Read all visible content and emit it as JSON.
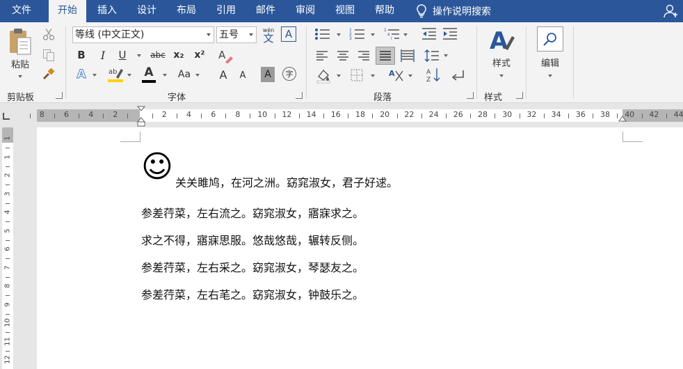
{
  "tabs": {
    "file": "文件",
    "home": "开始",
    "insert": "插入",
    "design": "设计",
    "layout": "布局",
    "references": "引用",
    "mailings": "邮件",
    "review": "审阅",
    "view": "视图",
    "help": "帮助"
  },
  "tell_me": "操作说明搜索",
  "clipboard": {
    "paste": "粘贴",
    "label": "剪贴板"
  },
  "font": {
    "name": "等线 (中文正文)",
    "size": "五号",
    "phonetic": "wén",
    "phonetic_char": "文",
    "border_char": "A",
    "bold": "B",
    "italic": "I",
    "underline": "U",
    "strike": "abc",
    "sub": "x₂",
    "sup": "x²",
    "text_effects": "A",
    "font_color": "A",
    "case": "Aa",
    "grow": "A",
    "shrink": "A",
    "shading": "A",
    "enclose": "字",
    "label": "字体",
    "highlight_color": "#ffd200",
    "font_color_bar": "#000000"
  },
  "paragraph": {
    "label": "段落"
  },
  "styles": {
    "button": "样式",
    "label": "样式"
  },
  "editing": {
    "button": "编辑"
  },
  "ruler": {
    "h": [
      "8",
      "6",
      "4",
      "2",
      "",
      "2",
      "4",
      "6",
      "8",
      "10",
      "12",
      "14",
      "16",
      "18",
      "20",
      "22",
      "24",
      "26",
      "28",
      "30",
      "32",
      "34",
      "36",
      "38",
      "40",
      "42",
      "44"
    ],
    "v": [
      "1",
      "1",
      "2",
      "3",
      "4",
      "5",
      "6",
      "7",
      "8",
      "9",
      "10",
      "11",
      "12"
    ]
  },
  "document": {
    "emoji": "☺",
    "lines": [
      "关关雎鸠，在河之洲。窈窕淑女，君子好逑。",
      "参差荇菜，左右流之。窈窕淑女，寤寐求之。",
      "求之不得，寤寐思服。悠哉悠哉，辗转反侧。",
      "参差荇菜，左右采之。窈窕淑女，琴瑟友之。",
      "参差荇菜，左右芼之。窈窕淑女，钟鼓乐之。"
    ]
  },
  "colors": {
    "accent": "#2b579a",
    "ribbon": "#f3f3f3"
  }
}
